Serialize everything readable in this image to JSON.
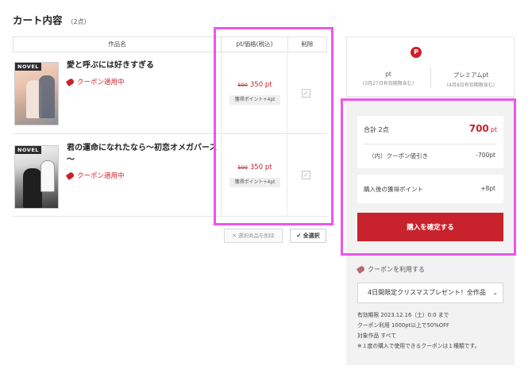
{
  "cart": {
    "title": "カート内容",
    "count": "（2点）"
  },
  "table": {
    "headers": {
      "title": "作品名",
      "price": "pt/価格(税込)",
      "delete": "削除"
    }
  },
  "items": [
    {
      "cover_tag": "NOVEL",
      "title": "愛と呼ぶには好きすぎる",
      "coupon": "クーポン適用中",
      "old_price": "500",
      "price": "350",
      "price_unit": "pt",
      "points": "獲得ポイント+4pt"
    },
    {
      "cover_tag": "NOVEL",
      "title": "君の運命になれたなら～初恋オメガバース～",
      "coupon": "クーポン適用中",
      "old_price": "500",
      "price": "350",
      "price_unit": "pt",
      "points": "獲得ポイント+4pt"
    }
  ],
  "actions": {
    "delete_selected": "✕ 選択商品を削除",
    "select_all": "✔ 全選択"
  },
  "points_card": {
    "logo": "P",
    "left_label": "pt",
    "left_sub": "(3月27日有効期限含む)",
    "right_label": "プレミアムpt",
    "right_sub": "(4月8日有効期限含む)"
  },
  "summary": {
    "total_label": "合計 2点",
    "total_value": "700",
    "total_unit": "pt",
    "discount_label": "（内）クーポン値引き",
    "discount_value": "-700pt",
    "earn_label": "購入後の獲得ポイント",
    "earn_value": "+8pt",
    "buy_button": "購入を確定する"
  },
  "coupon": {
    "use_label": "クーポンを利用する",
    "selected": "4日間限定クリスマスプレゼント！全作品",
    "info": [
      "有効期限  2023.12.16（土）0:0 まで",
      "クーポン利用  1000pt以上で50%OFF",
      "対象作品  すべて",
      "※１度の購入で使用できるクーポンは１種類です。"
    ]
  },
  "colors": {
    "accent": "#c8232c",
    "highlight": "#ee55ee"
  }
}
